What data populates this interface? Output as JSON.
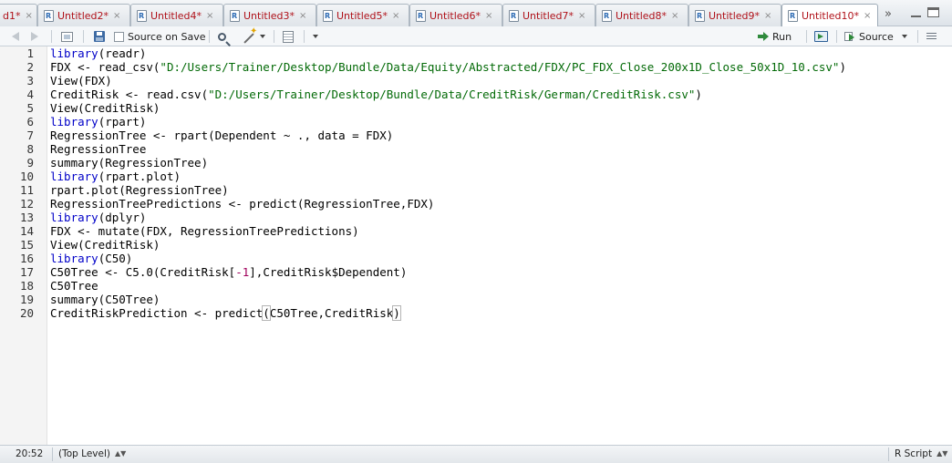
{
  "tabs": [
    {
      "label": "d1*",
      "active": false
    },
    {
      "label": "Untitled2*",
      "active": false
    },
    {
      "label": "Untitled4*",
      "active": false
    },
    {
      "label": "Untitled3*",
      "active": false
    },
    {
      "label": "Untitled5*",
      "active": false
    },
    {
      "label": "Untitled6*",
      "active": false
    },
    {
      "label": "Untitled7*",
      "active": false
    },
    {
      "label": "Untitled8*",
      "active": false
    },
    {
      "label": "Untitled9*",
      "active": false
    },
    {
      "label": "Untitled10*",
      "active": true
    }
  ],
  "tab_close_glyph": "×",
  "more_tabs_glyph": "»",
  "toolbar": {
    "source_on_save_label": "Source on Save",
    "run_label": "Run",
    "source_label": "Source"
  },
  "editor": {
    "line_numbers": [
      "1",
      "2",
      "3",
      "4",
      "5",
      "6",
      "7",
      "8",
      "9",
      "10",
      "11",
      "12",
      "13",
      "14",
      "15",
      "16",
      "17",
      "18",
      "19",
      "20"
    ],
    "lines": [
      "library(readr)",
      "FDX <- read_csv(\"D:/Users/Trainer/Desktop/Bundle/Data/Equity/Abstracted/FDX/PC_FDX_Close_200x1D_Close_50x1D_10.csv\")",
      "View(FDX)",
      "CreditRisk <- read.csv(\"D:/Users/Trainer/Desktop/Bundle/Data/CreditRisk/German/CreditRisk.csv\")",
      "View(CreditRisk)",
      "library(rpart)",
      "RegressionTree <- rpart(Dependent ~ ., data = FDX)",
      "RegressionTree",
      "summary(RegressionTree)",
      "library(rpart.plot)",
      "rpart.plot(RegressionTree)",
      "RegressionTreePredictions <- predict(RegressionTree,FDX)",
      "library(dplyr)",
      "FDX <- mutate(FDX, RegressionTreePredictions)",
      "View(CreditRisk)",
      "library(C50)",
      "C50Tree <- C5.0(CreditRisk[-1],CreditRisk$Dependent)",
      "C50Tree",
      "summary(C50Tree)",
      "CreditRiskPrediction <- predict(C50Tree,CreditRisk)"
    ]
  },
  "status": {
    "cursor_position": "20:52",
    "scope": "(Top Level)",
    "file_type": "R Script"
  },
  "icons": {
    "back": "back-arrow-icon",
    "forward": "forward-arrow-icon",
    "save": "save-icon",
    "find": "magnifier-icon",
    "code_tools": "magic-wand-icon",
    "run": "run-arrow-icon",
    "rerun": "rerun-icon",
    "source": "source-icon",
    "outline": "outline-menu-icon"
  },
  "colors": {
    "keyword": "#0000c8",
    "string": "#036a07",
    "number": "#a0005c",
    "tab_modified_label": "#b0121a"
  }
}
